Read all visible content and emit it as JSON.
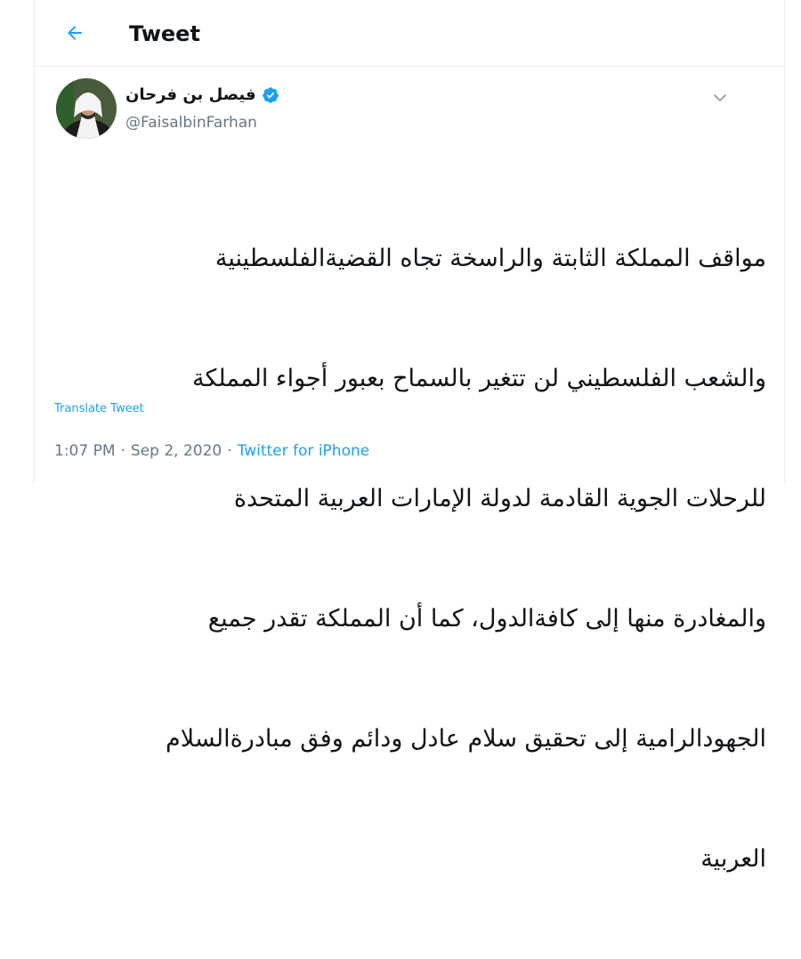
{
  "header": {
    "back_icon": "arrow-left-icon",
    "title": "Tweet"
  },
  "author": {
    "display_name": "فيصل بن فرحان",
    "handle": "@FaisalbinFarhan",
    "verified_icon": "verified-badge-icon",
    "menu_icon": "chevron-down-icon"
  },
  "tweet": {
    "lines": [
      "مواقف المملكة الثابتة والراسخة تجاه القضيةالفلسطينية",
      "والشعب الفلسطيني لن تتغير بالسماح بعبور أجواء المملكة",
      "للرحلات الجوية القادمة لدولة الإمارات العربية المتحدة",
      "والمغادرة منها إلى كافةالدول، كما أن المملكة تقدر جميع",
      "الجهودالرامية إلى تحقيق سلام عادل ودائم وفق مبادرةالسلام",
      "العربية"
    ],
    "translate_label": "Translate Tweet",
    "time": "1:07 PM",
    "date": "Sep 2, 2020",
    "separator": "·",
    "source": "Twitter for iPhone"
  },
  "colors": {
    "accent": "#1da1f2",
    "secondary_text": "#657786",
    "border": "#e6ecf0"
  }
}
